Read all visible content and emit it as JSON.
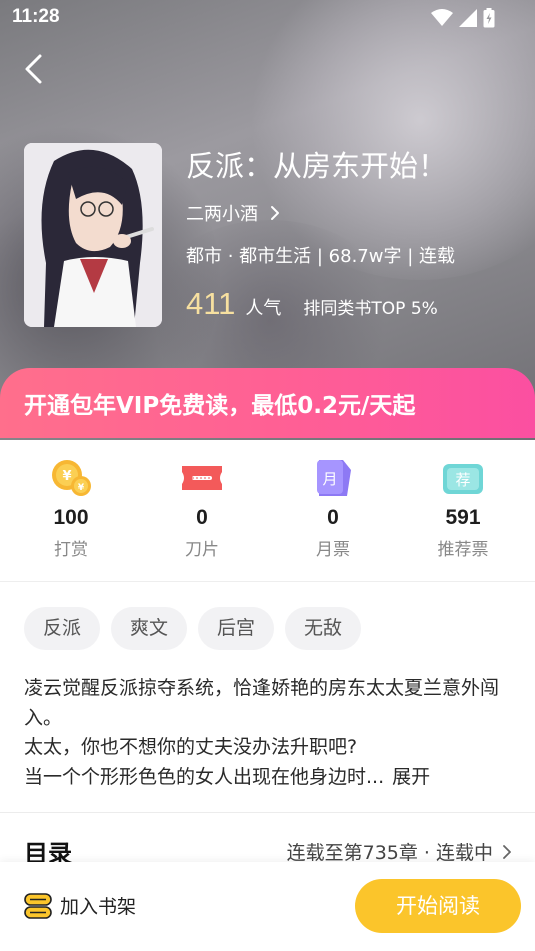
{
  "status_bar": {
    "time": "11:28"
  },
  "book": {
    "title": "反派：从房东开始！",
    "author": "二两小酒",
    "meta": "都市 · 都市生活 | 68.7w字 | 连载",
    "popularity_value": "411",
    "popularity_unit": "人气",
    "rank_text": "排同类书TOP 5%"
  },
  "vip_banner": {
    "text": "开通包年VIP免费读，最低0.2元/天起"
  },
  "stats": [
    {
      "value": "100",
      "label": "打赏",
      "icon": "coin-icon"
    },
    {
      "value": "0",
      "label": "刀片",
      "icon": "blade-icon"
    },
    {
      "value": "0",
      "label": "月票",
      "icon": "month-ticket-icon"
    },
    {
      "value": "591",
      "label": "推荐票",
      "icon": "recommend-ticket-icon"
    }
  ],
  "icon_text": {
    "month": "月",
    "recommend": "荐"
  },
  "tags": [
    "反派",
    "爽文",
    "后宫",
    "无敌"
  ],
  "intro": {
    "line1": "凌云觉醒反派掠夺系统，恰逢娇艳的房东太太夏兰意外闯入。",
    "line2": "太太，你也不想你的丈夫没办法升职吧?",
    "line3": "当一个个形形色色的女人出现在他身边时...",
    "expand": "展开"
  },
  "catalog": {
    "title": "目录",
    "info": "连载至第735章 · 连载中"
  },
  "bottom": {
    "shelf_label": "加入书架",
    "read_label": "开始阅读"
  },
  "colors": {
    "vip": "#ff5f95",
    "read_button": "#fbc52b",
    "popularity": "#f7e0a0"
  }
}
